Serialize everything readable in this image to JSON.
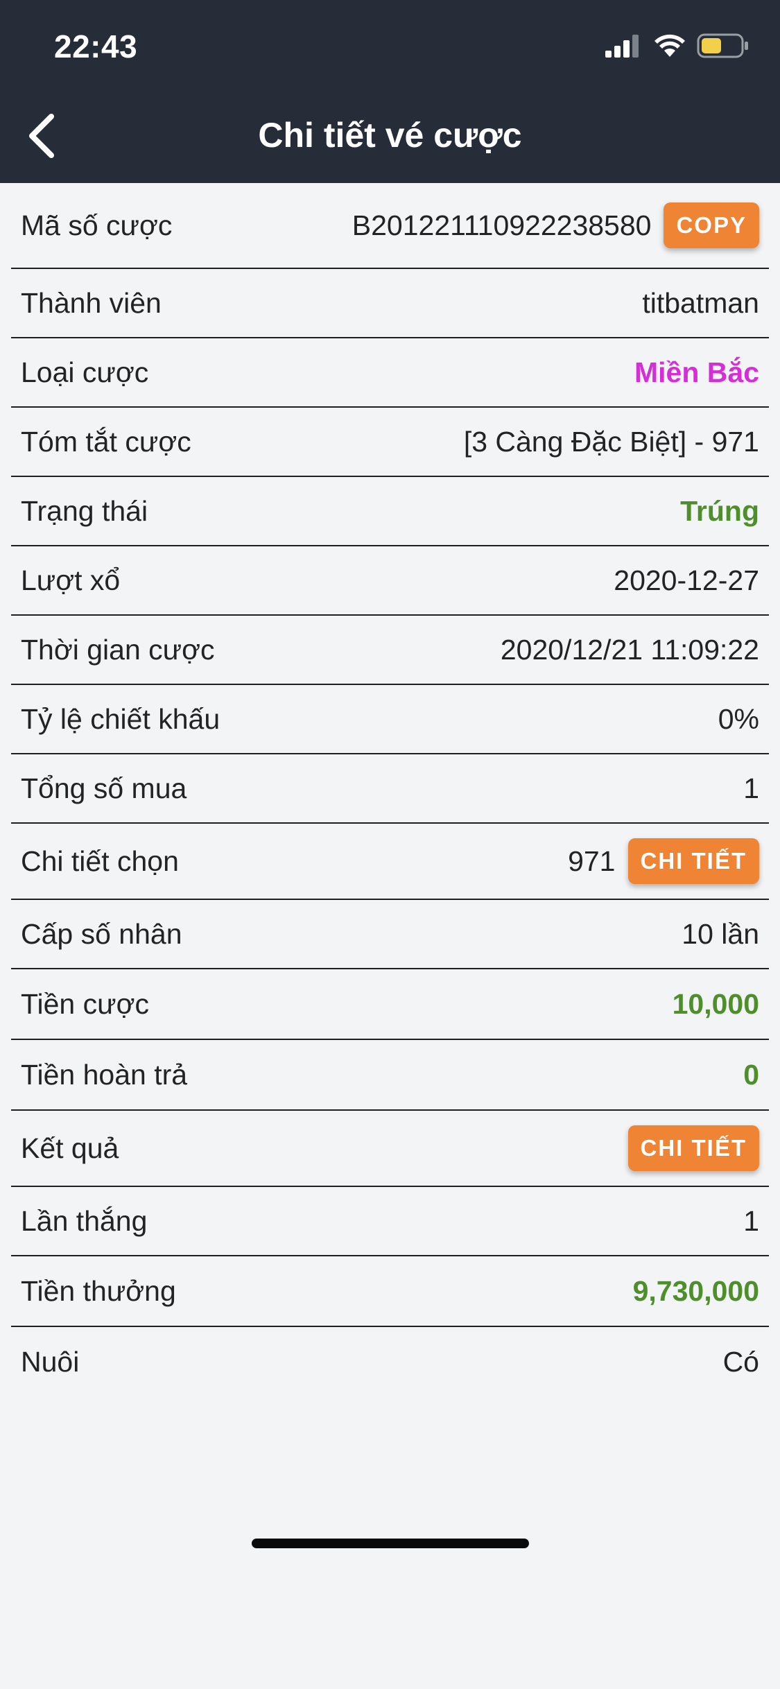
{
  "status_bar": {
    "time": "22:43",
    "signal_icon": "cellular-signal-icon",
    "wifi_icon": "wifi-icon",
    "battery_icon": "battery-icon",
    "battery_color": "#f2d04a"
  },
  "header": {
    "back_icon": "chevron-left-icon",
    "title": "Chi tiết vé cược"
  },
  "colors": {
    "header_bg": "#272d38",
    "button_bg": "#ef8434",
    "magenta": "#d42fd6",
    "green": "#4e8f2c"
  },
  "rows": [
    {
      "label": "Mã số cược",
      "value": "B201221110922238580",
      "button": "COPY"
    },
    {
      "label": "Thành viên",
      "value": "titbatman"
    },
    {
      "label": "Loại cược",
      "value": "Miền Bắc"
    },
    {
      "label": "Tóm tắt cược",
      "value": "[3 Càng Đặc Biệt] - 971"
    },
    {
      "label": "Trạng thái",
      "value": "Trúng"
    },
    {
      "label": "Lượt xổ",
      "value": "2020-12-27"
    },
    {
      "label": "Thời gian cược",
      "value": "2020/12/21 11:09:22"
    },
    {
      "label": "Tỷ lệ chiết khấu",
      "value": "0%"
    },
    {
      "label": "Tổng số mua",
      "value": "1"
    },
    {
      "label": "Chi tiết chọn",
      "value": "971",
      "button": "CHI TIẾT"
    },
    {
      "label": "Cấp số nhân",
      "value": "10 lần"
    },
    {
      "label": "Tiền cược",
      "value": "10,000"
    },
    {
      "label": "Tiền hoàn trả",
      "value": "0"
    },
    {
      "label": "Kết quả",
      "button": "CHI TIẾT"
    },
    {
      "label": "Lần thắng",
      "value": "1"
    },
    {
      "label": "Tiền thưởng",
      "value": "9,730,000"
    },
    {
      "label": "Nuôi",
      "value": "Có"
    }
  ]
}
